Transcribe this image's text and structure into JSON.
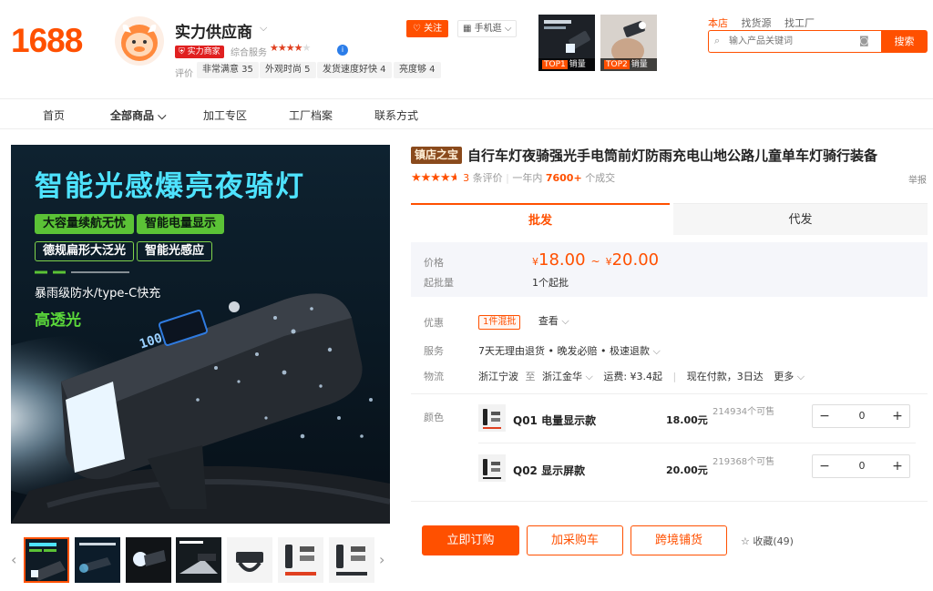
{
  "header": {
    "logo": "1688",
    "shop_name": "实力供应商",
    "power_badge": "实力商家",
    "service_label": "综合服务",
    "service_stars": "★★★★",
    "service_stars_empty": "★",
    "eval_label": "评价",
    "tags": [
      "非常满意 35",
      "外观时尚 5",
      "发货速度好快 4",
      "亮度够 4"
    ],
    "follow_label": "关注",
    "mobile_label": "手机逛",
    "top_items": [
      {
        "rank": "TOP1",
        "label": "销量"
      },
      {
        "rank": "TOP2",
        "label": "销量"
      }
    ],
    "search_tabs": [
      "本店",
      "找货源",
      "找工厂"
    ],
    "search_placeholder": "输入产品关键词",
    "search_button": "搜索"
  },
  "nav": {
    "items": [
      "首页",
      "全部商品",
      "加工专区",
      "工厂档案",
      "联系方式"
    ]
  },
  "gallery": {
    "headline": "智能光感爆亮夜骑灯",
    "features": [
      "大容量续航无忧",
      "智能电量显示",
      "德规扁形大泛光",
      "智能光感应"
    ],
    "subline": "暴雨级防水/type-C快充",
    "highlight": "高透光",
    "lamp_display": "100"
  },
  "product": {
    "store_badge": "镇店之宝",
    "title": "自行车灯夜骑强光手电筒前灯防雨充电山地公路儿童单车灯骑行装备",
    "rating": 4.5,
    "review_count": "3",
    "review_suffix": "条评价",
    "sales_prefix": "一年内",
    "sales_count": "7600+",
    "sales_suffix": "个成交",
    "report_label": "举报",
    "tabs": [
      "批发",
      "代发"
    ],
    "price_label": "价格",
    "currency": "¥",
    "price_min": "18.00",
    "price_tilde": "~",
    "price_max": "20.00",
    "moq_label": "起批量",
    "moq_value": "1个起批",
    "promo_label": "优惠",
    "promo_badge": "1件混批",
    "promo_link": "查看",
    "service_label": "服务",
    "service_value": "7天无理由退货 • 晚发必赔 • 极速退款",
    "logistics_label": "物流",
    "logistics_from": "浙江宁波",
    "logistics_to_word": "至",
    "logistics_to": "浙江金华",
    "logistics_fee": "运费: ¥3.4起",
    "logistics_eta": "现在付款，3日达",
    "logistics_more": "更多",
    "color_label": "颜色",
    "skus": [
      {
        "name": "Q01 电量显示款",
        "price": "18.00元",
        "stock": "214934个可售",
        "qty": "0"
      },
      {
        "name": "Q02 显示屏款",
        "price": "20.00元",
        "stock": "219368个可售",
        "qty": "0"
      }
    ],
    "actions": {
      "order": "立即订购",
      "cart": "加采购车",
      "cross": "跨境铺货",
      "favorite": "收藏(49)"
    }
  },
  "colors": {
    "accent": "#ff5000",
    "nav_bg": "#ffffff",
    "hero_bg": "#0f1b25",
    "hero_title": "#4ee3ff",
    "feature_green": "#5bc236"
  }
}
